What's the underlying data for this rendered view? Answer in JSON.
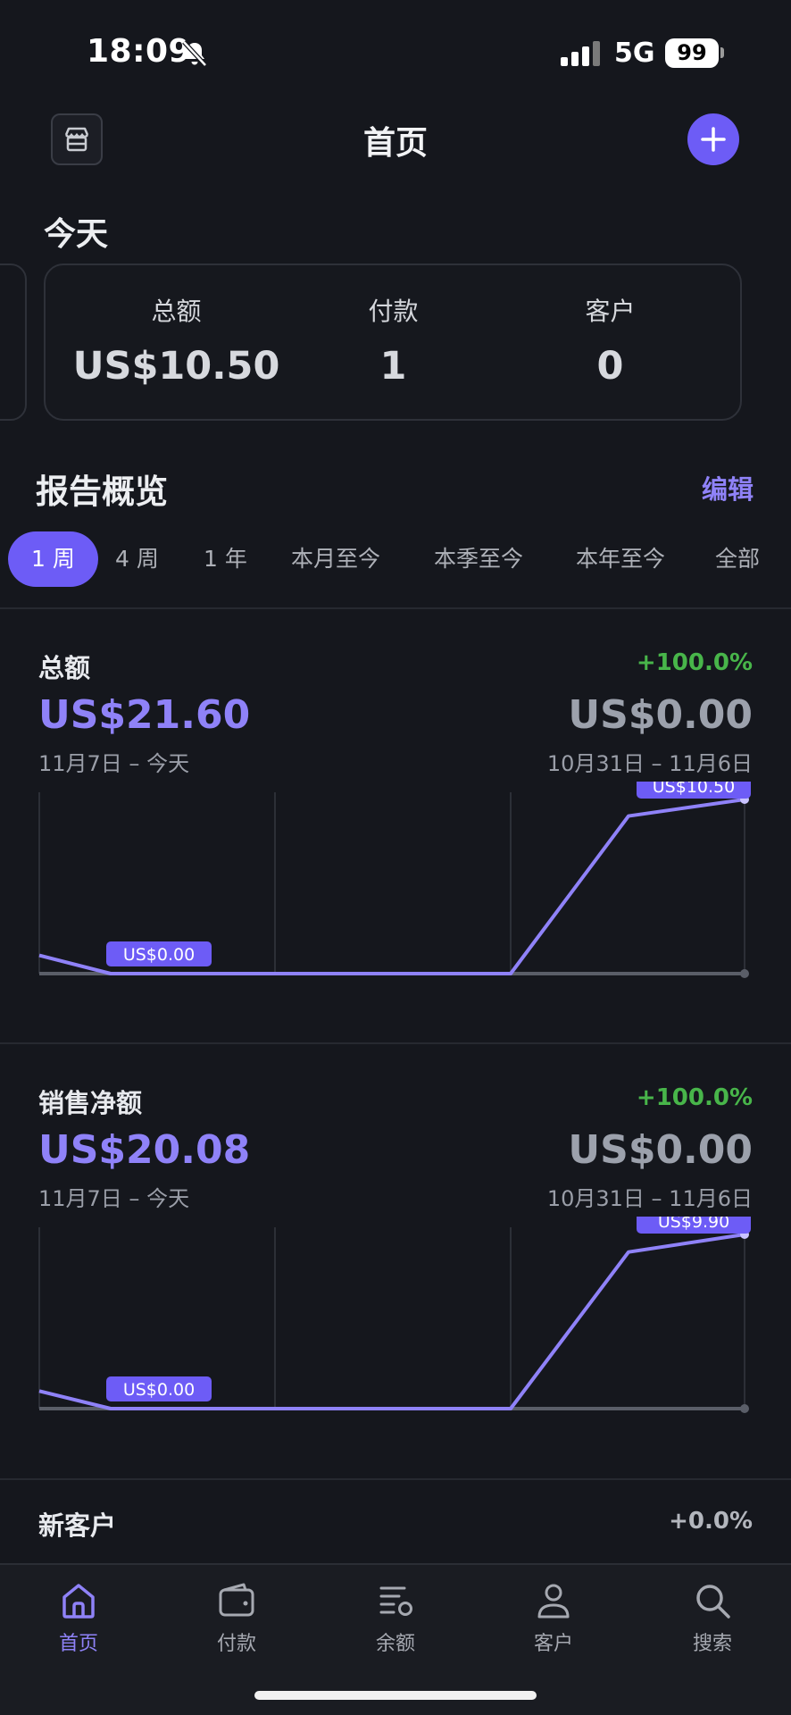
{
  "status_bar": {
    "time": "18:09",
    "network": "5G",
    "battery": "99"
  },
  "header": {
    "title": "首页"
  },
  "today": {
    "title": "今天",
    "stats": [
      {
        "label": "总额",
        "value": "US$10.50"
      },
      {
        "label": "付款",
        "value": "1"
      },
      {
        "label": "客户",
        "value": "0"
      }
    ]
  },
  "report": {
    "title": "报告概览",
    "edit_label": "编辑",
    "ranges": [
      "1 周",
      "4 周",
      "1 年",
      "本月至今",
      "本季至今",
      "本年至今",
      "全部"
    ],
    "active_range": "1 周"
  },
  "metrics": [
    {
      "name": "总额",
      "change": "+100.0%",
      "value": "US$21.60",
      "compare_value": "US$0.00",
      "period": "11月7日 – 今天",
      "compare_period": "10月31日 – 11月6日"
    },
    {
      "name": "销售净额",
      "change": "+100.0%",
      "value": "US$20.08",
      "compare_value": "US$0.00",
      "period": "11月7日 – 今天",
      "compare_period": "10月31日 – 11月6日"
    }
  ],
  "new_customers": {
    "name": "新客户",
    "change": "+0.0%"
  },
  "chart_data": [
    {
      "type": "line",
      "series": [
        {
          "values": [
            1.1,
            0,
            0,
            0,
            0,
            0,
            9.5,
            10.5
          ]
        },
        {
          "values": [
            0,
            0,
            0,
            0,
            0,
            0,
            0,
            0
          ]
        }
      ],
      "data_labels": [
        "US$0.00",
        "US$10.50"
      ],
      "ylim": [
        0,
        10.5
      ],
      "colors": {
        "current": "#8f82f8",
        "previous": "#5a5e68"
      }
    },
    {
      "type": "line",
      "series": [
        {
          "values": [
            1.0,
            0,
            0,
            0,
            0,
            0,
            8.9,
            9.9
          ]
        },
        {
          "values": [
            0,
            0,
            0,
            0,
            0,
            0,
            0,
            0
          ]
        }
      ],
      "data_labels": [
        "US$0.00",
        "US$9.90"
      ],
      "ylim": [
        0,
        9.9
      ],
      "colors": {
        "current": "#8f82f8",
        "previous": "#5a5e68"
      }
    }
  ],
  "nav": [
    {
      "label": "首页",
      "icon": "home-icon",
      "active": true
    },
    {
      "label": "付款",
      "icon": "wallet-icon",
      "active": false
    },
    {
      "label": "余额",
      "icon": "balance-icon",
      "active": false
    },
    {
      "label": "客户",
      "icon": "person-icon",
      "active": false
    },
    {
      "label": "搜索",
      "icon": "search-icon",
      "active": false
    }
  ],
  "colors": {
    "accent": "#6d5cf6",
    "accent_text": "#8f82f8",
    "positive": "#48b54a",
    "background": "#15171d"
  }
}
